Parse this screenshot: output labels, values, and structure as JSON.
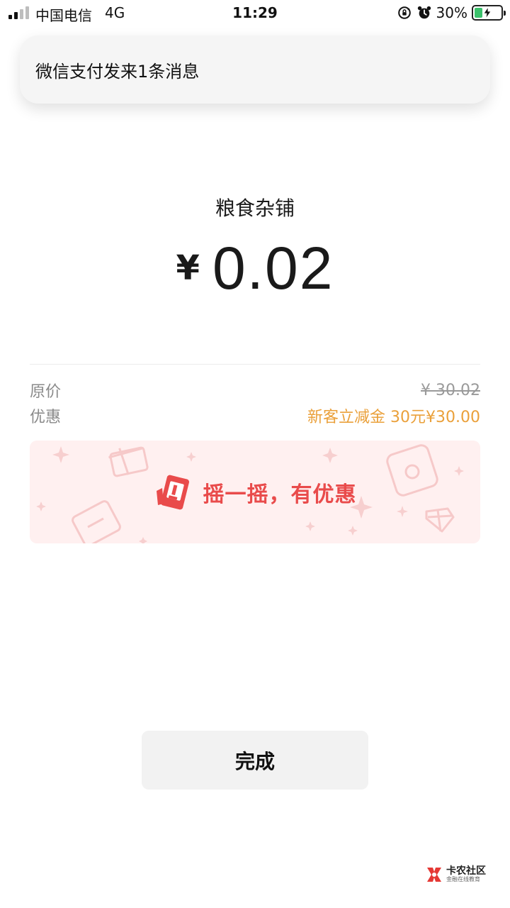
{
  "status_bar": {
    "carrier": "中国电信",
    "network": "4G",
    "time": "11:29",
    "battery": "30%",
    "battery_fraction": 0.3,
    "icons": [
      "signal-icon",
      "rotation-lock-icon",
      "alarm-icon",
      "battery-charging-icon"
    ]
  },
  "notification": {
    "text": "微信支付发来1条消息"
  },
  "payment": {
    "merchant": "粮食杂铺",
    "currency_symbol": "¥",
    "amount": "0.02"
  },
  "details": {
    "original_price_label": "原价",
    "original_price_value": "¥ 30.02",
    "discount_label": "优惠",
    "discount_value": "新客立减金 30元¥30.00"
  },
  "promo": {
    "text": "摇一摇，有优惠",
    "icon": "shake-phone-icon"
  },
  "done_button": {
    "label": "完成"
  },
  "watermark": {
    "title": "卡农社区",
    "subtitle": "金融在线教育"
  },
  "colors": {
    "discount_orange": "#eaa03a",
    "promo_red": "#e94b4b",
    "promo_bg": "#fff0f0",
    "battery_green": "#3bc16b"
  }
}
